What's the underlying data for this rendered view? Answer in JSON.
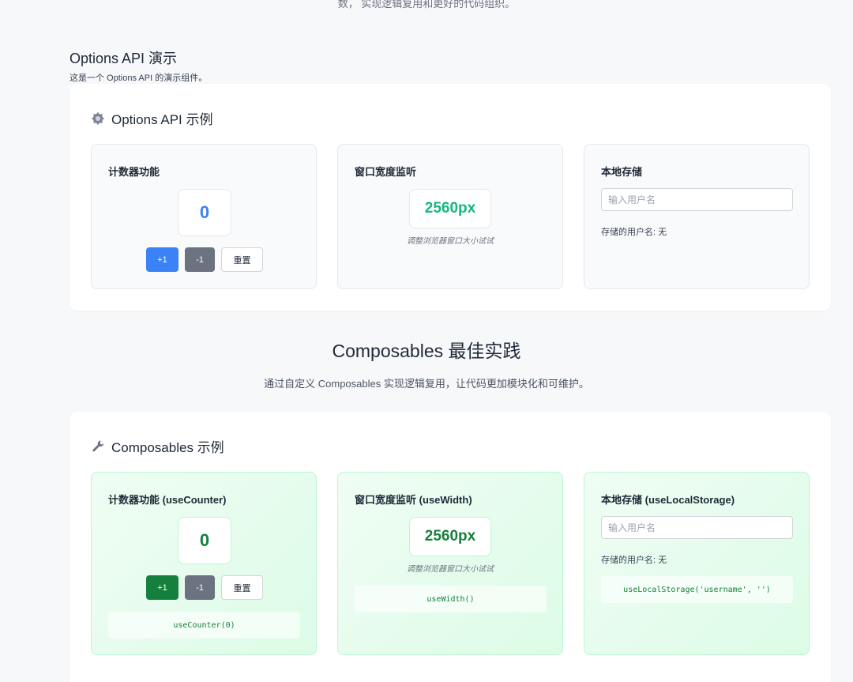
{
  "top_text": "数， 实现逻辑复用和更好的代码组织。",
  "options_section": {
    "title": "Options API 演示",
    "subtitle": "这是一个 Options API 的演示组件。"
  },
  "options_card": {
    "title": "Options API 示例",
    "icon": "gear-icon",
    "counter": {
      "title": "计数器功能",
      "value": "0",
      "inc_label": "+1",
      "dec_label": "-1",
      "reset_label": "重置"
    },
    "width": {
      "title": "窗口宽度监听",
      "value": "2560px",
      "hint": "调整浏览器窗口大小试试"
    },
    "storage": {
      "title": "本地存储",
      "placeholder": "输入用户名",
      "stored_text": "存储的用户名: 无"
    }
  },
  "composables_section": {
    "title": "Composables 最佳实践",
    "subtitle": "通过自定义 Composables 实现逻辑复用，让代码更加模块化和可维护。"
  },
  "composables_card": {
    "title": "Composables 示例",
    "icon": "wrench-icon",
    "counter": {
      "title": "计数器功能 (useCounter)",
      "value": "0",
      "inc_label": "+1",
      "dec_label": "-1",
      "reset_label": "重置",
      "code": "useCounter(0)"
    },
    "width": {
      "title": "窗口宽度监听 (useWidth)",
      "value": "2560px",
      "hint": "调整浏览器窗口大小试试",
      "code": "useWidth()"
    },
    "storage": {
      "title": "本地存储 (useLocalStorage)",
      "placeholder": "输入用户名",
      "stored_text": "存储的用户名: 无",
      "code": "useLocalStorage('username', '')"
    }
  },
  "colors": {
    "primary": "#3b82f6",
    "success": "#15803d",
    "neutral": "#6b7280"
  }
}
